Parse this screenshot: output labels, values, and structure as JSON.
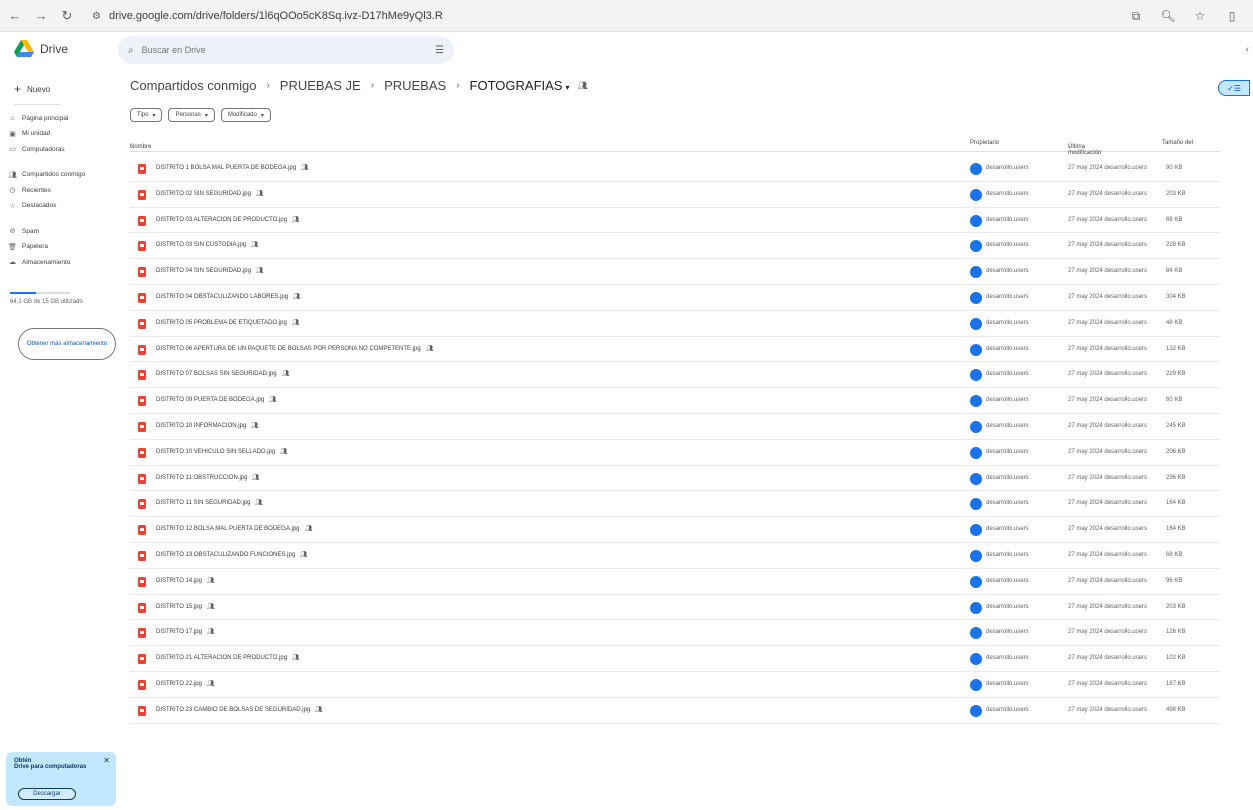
{
  "browser": {
    "url": "drive.google.com/drive/folders/1l6qOOo5cK8Sq.ivz-D17hMe9yQl3.R"
  },
  "app": {
    "logo_text": "Drive",
    "search_placeholder": "Buscar en Drive"
  },
  "sidebar": {
    "new_label": "Nuevo",
    "items": [
      {
        "label": "Página principal",
        "icon": "home-icon"
      },
      {
        "label": "Mi unidad",
        "icon": "drive-icon"
      },
      {
        "label": "Computadoras",
        "icon": "computer-icon"
      },
      {
        "label": "Compartidos conmigo",
        "icon": "people-icon"
      },
      {
        "label": "Recientes",
        "icon": "clock-icon"
      },
      {
        "label": "Destacados",
        "icon": "star-icon"
      },
      {
        "label": "Spam",
        "icon": "spam-icon"
      },
      {
        "label": "Papelera",
        "icon": "trash-icon"
      },
      {
        "label": "Almacenamiento",
        "icon": "cloud-icon"
      }
    ],
    "storage_text": "64,1 GB de 15 GB utilizado",
    "storage_fraction": 0.43,
    "storage_button": "Obtener más almacenamiento"
  },
  "promo": {
    "title": "Obtén",
    "subtitle": "Drive para computadoras",
    "button": "Descargar"
  },
  "breadcrumb": {
    "items": [
      "Compartidos conmigo",
      "PRUEBAS JE",
      "PRUEBAS"
    ],
    "current": "FOTOGRAFIAS"
  },
  "filters": [
    "Tipo",
    "Personas",
    "Modificado"
  ],
  "table": {
    "headers": {
      "name": "Nombre",
      "owner": "Propietario",
      "modified": "Última modificación",
      "size": "Tamaño del"
    },
    "rows": [
      {
        "name": "DISTRITO 1 BOLSA MAL PUERTA DE BODEGA.jpg",
        "owner": "desarrollo.users",
        "modified": "27 may 2024 desarrollo.users",
        "size": "90 KB"
      },
      {
        "name": "DISTRITO 02 SIN SEGURIDAD.jpg",
        "owner": "desarrollo.users",
        "modified": "27 may 2024 desarrollo.users",
        "size": "203 KB"
      },
      {
        "name": "DISTRITO 03 ALTERACION DE PRODUCTO.jpg",
        "owner": "desarrollo.users",
        "modified": "27 may 2024 desarrollo.users",
        "size": "88 KB"
      },
      {
        "name": "DISTRITO 03 SIN CUSTODIA.jpg",
        "owner": "desarrollo.users",
        "modified": "27 may 2024 desarrollo.users",
        "size": "228 KB"
      },
      {
        "name": "DISTRITO 04 SIN SEGURIDAD.jpg",
        "owner": "desarrollo.users",
        "modified": "27 may 2024 desarrollo.users",
        "size": "84 KB"
      },
      {
        "name": "DISTRITO 04 OBSTACULIZANDO LABORES.jpg",
        "owner": "desarrollo.users",
        "modified": "27 may 2024 desarrollo.users",
        "size": "304 KB"
      },
      {
        "name": "DISTRITO 05 PROBLEMA DE ETIQUETADO.jpg",
        "owner": "desarrollo.users",
        "modified": "27 may 2024 desarrollo.users",
        "size": "48 KB"
      },
      {
        "name": "DISTRITO 06 APERTURA DE UN PAQUETE DE BOLSAS POR PERSONA NO COMPETENTE.jpg",
        "owner": "desarrollo.users",
        "modified": "27 may 2024 desarrollo.users",
        "size": "132 KB"
      },
      {
        "name": "DISTRITO 07 BOLSAS SIN SEGURIDAD.jpg",
        "owner": "desarrollo.users",
        "modified": "27 may 2024 desarrollo.users",
        "size": "229 KB"
      },
      {
        "name": "DISTRITO 09 PUERTA DE BODEGA.jpg",
        "owner": "desarrollo.users",
        "modified": "27 may 2024 desarrollo.users",
        "size": "60 KB"
      },
      {
        "name": "DISTRITO 10 INFORMACION.jpg",
        "owner": "desarrollo.users",
        "modified": "27 may 2024 desarrollo.users",
        "size": "245 KB"
      },
      {
        "name": "DISTRITO 10 VEHICULO SIN SELLADO.jpg",
        "owner": "desarrollo.users",
        "modified": "27 may 2024 desarrollo.users",
        "size": "206 KB"
      },
      {
        "name": "DISTRITO 11 OBSTRUCCION.jpg",
        "owner": "desarrollo.users",
        "modified": "27 may 2024 desarrollo.users",
        "size": "296 KB"
      },
      {
        "name": "DISTRITO 11 SIN SEGURIDAD.jpg",
        "owner": "desarrollo.users",
        "modified": "27 may 2024 desarrollo.users",
        "size": "164 KB"
      },
      {
        "name": "DISTRITO 12 BOLSA MAL PUERTA DE BODEGA.jpg",
        "owner": "desarrollo.users",
        "modified": "27 may 2024 desarrollo.users",
        "size": "164 KB"
      },
      {
        "name": "DISTRITO 13 OBSTACULIZANDO FUNCIONES.jpg",
        "owner": "desarrollo.users",
        "modified": "27 may 2024 desarrollo.users",
        "size": "68 KB"
      },
      {
        "name": "DISTRITO 14.jpg",
        "owner": "desarrollo.users",
        "modified": "27 may 2024 desarrollo.users",
        "size": "96 KB"
      },
      {
        "name": "DISTRITO 15.jpg",
        "owner": "desarrollo.users",
        "modified": "27 may 2024 desarrollo.users",
        "size": "203 KB"
      },
      {
        "name": "DISTRITO 17.jpg",
        "owner": "desarrollo.users",
        "modified": "27 may 2024 desarrollo.users",
        "size": "126 KB"
      },
      {
        "name": "DISTRITO 21 ALTERACION DE PRODUCTO.jpg",
        "owner": "desarrollo.users",
        "modified": "27 may 2024 desarrollo.users",
        "size": "102 KB"
      },
      {
        "name": "DISTRITO 22.jpg",
        "owner": "desarrollo.users",
        "modified": "27 may 2024 desarrollo.users",
        "size": "187 KB"
      },
      {
        "name": "DISTRITO 23 CAMBIO DE BOLSAS DE SEGURIDAD.jpg",
        "owner": "desarrollo.users",
        "modified": "27 may 2024 desarrollo.users",
        "size": "498 KB"
      }
    ]
  },
  "colors": {
    "accent": "#1a73e8",
    "file_icon": "#ea4335",
    "chip_selected_bg": "#c2e7ff"
  }
}
